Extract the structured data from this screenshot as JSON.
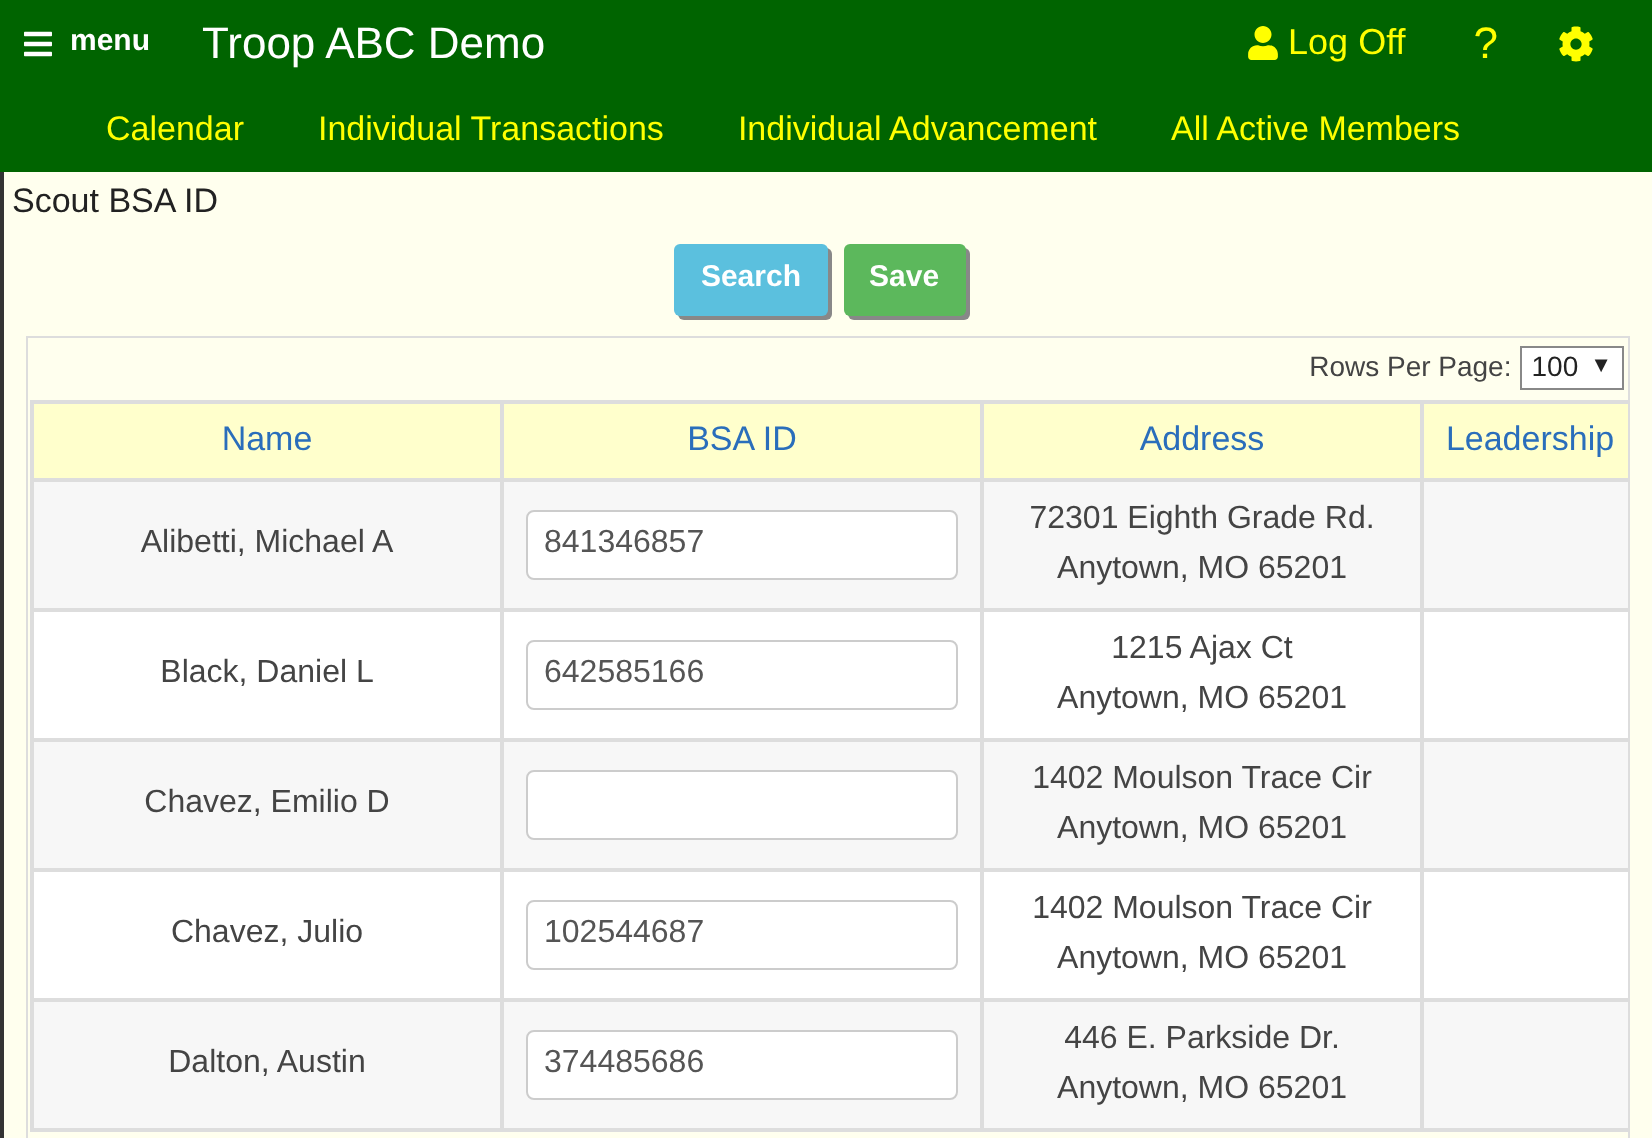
{
  "header": {
    "menu_label": "menu",
    "title": "Troop ABC Demo",
    "logoff_label": "Log Off",
    "help_label": "?"
  },
  "nav": [
    {
      "label": "Calendar"
    },
    {
      "label": "Individual Transactions"
    },
    {
      "label": "Individual Advancement"
    },
    {
      "label": "All Active Members"
    }
  ],
  "page_title": "Scout BSA ID",
  "buttons": [
    {
      "label": "Search",
      "kind": "search"
    },
    {
      "label": "Save",
      "kind": "save"
    }
  ],
  "rows_per_page": {
    "label": "Rows Per Page:",
    "value": "100",
    "caret": "▼"
  },
  "table": {
    "columns": [
      "Name",
      "BSA ID",
      "Address",
      "Leadership"
    ],
    "rows": [
      {
        "name": "Alibetti, Michael A",
        "bsa_id": "841346857",
        "address": [
          "72301 Eighth Grade Rd.",
          "Anytown, MO 65201"
        ]
      },
      {
        "name": "Black, Daniel L",
        "bsa_id": "642585166",
        "address": [
          "1215 Ajax Ct",
          "Anytown, MO 65201"
        ]
      },
      {
        "name": "Chavez, Emilio D",
        "address": [
          "1402 Moulson Trace Cir",
          "Anytown, MO 65201"
        ]
      },
      {
        "name": "Chavez, Julio",
        "bsa_id": "102544687",
        "address": [
          "1402 Moulson Trace Cir",
          "Anytown, MO 65201"
        ]
      },
      {
        "name": "Dalton, Austin",
        "bsa_id": "374485686",
        "address": [
          "446 E. Parkside Dr.",
          "Anytown, MO 65201"
        ]
      }
    ]
  }
}
